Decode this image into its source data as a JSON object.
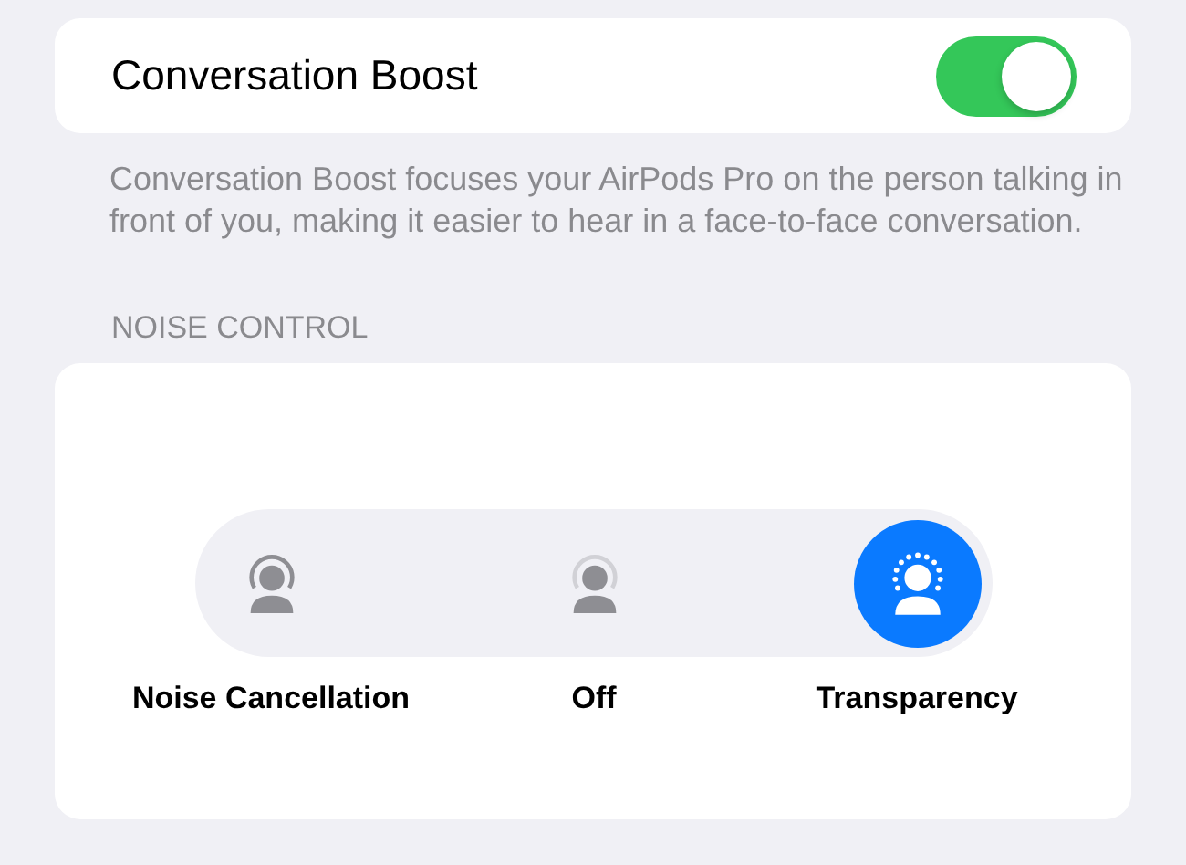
{
  "boost": {
    "label": "Conversation Boost",
    "on": true
  },
  "description": "Conversation Boost focuses your AirPods Pro on the person talking in front of you, making it easier to hear in a face-to-face conversation.",
  "section_header": "NOISE CONTROL",
  "modes": [
    {
      "kind": "cancellation",
      "label": "Noise Cancellation",
      "selected": false
    },
    {
      "kind": "off",
      "label": "Off",
      "selected": false
    },
    {
      "kind": "transparency",
      "label": "Transparency",
      "selected": true
    }
  ]
}
